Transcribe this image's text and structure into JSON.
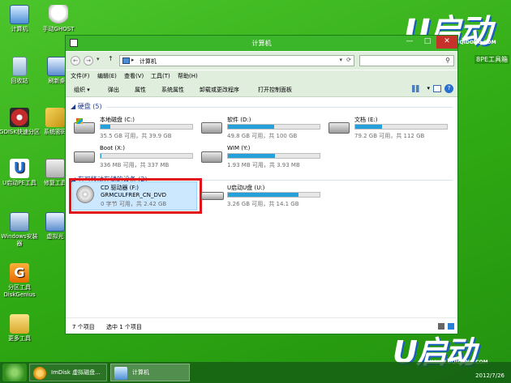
{
  "desktop": {
    "icons": [
      {
        "label": "计算机",
        "icon": "computer-icon"
      },
      {
        "label": "手动GHOST",
        "icon": "ghost-icon"
      },
      {
        "label": "回收站",
        "icon": "recycle-bin-icon"
      },
      {
        "label": "刷新桌",
        "icon": "network-icon"
      },
      {
        "label": "GDISK快速分区",
        "icon": "disk-icon"
      },
      {
        "label": "系统密码",
        "icon": "key-icon"
      },
      {
        "label": "U启动PE工具",
        "icon": "u-logo-icon"
      },
      {
        "label": "修复工具",
        "icon": "tool-icon"
      },
      {
        "label": "Windows安装器",
        "icon": "windows-installer-icon"
      },
      {
        "label": "虚拟光",
        "icon": "network-icon"
      },
      {
        "label": "分区工具DiskGenius",
        "icon": "diskgenius-icon"
      },
      {
        "label": "更多工具",
        "icon": "folder-icon"
      }
    ],
    "logo_text": "启动",
    "logo_letter": "U",
    "logo_url": "WWW.UQIDONG.COM",
    "pe_text": "8PE工具箱",
    "bottom_logo_text": "启动",
    "bottom_logo_url": "WWW.UQIDONG.COM",
    "date": "2012/7/26"
  },
  "window": {
    "title": "计算机",
    "minimize": "—",
    "maximize": "□",
    "close": "✕",
    "address": {
      "location": "计算机",
      "back": "←",
      "forward": "→",
      "up": "↑"
    },
    "menu": [
      "文件(F)",
      "编辑(E)",
      "查看(V)",
      "工具(T)",
      "帮助(H)"
    ],
    "toolbar": [
      "组织 ▾",
      "弹出",
      "属性",
      "系统属性",
      "卸载或更改程序",
      "打开控制面板"
    ],
    "help": "?",
    "groups": {
      "hard_disks": "硬盘 (5)",
      "removable": "有可移动存储的设备 (2)"
    },
    "drives": [
      {
        "name": "本地磁盘 (C:)",
        "free": "35.5 GB 可用，共 39.9 GB",
        "used_fraction": 0.11,
        "win": true
      },
      {
        "name": "软件 (D:)",
        "free": "49.8 GB 可用，共 100 GB",
        "used_fraction": 0.5,
        "win": false
      },
      {
        "name": "文档 (E:)",
        "free": "79.2 GB 可用，共 112 GB",
        "used_fraction": 0.29,
        "win": false
      },
      {
        "name": "Boot (X:)",
        "free": "336 MB 可用，共 337 MB",
        "used_fraction": 0.01,
        "win": false
      },
      {
        "name": "WIM (Y:)",
        "free": "1.93 MB 可用，共 3.93 MB",
        "used_fraction": 0.51,
        "win": false
      }
    ],
    "cd_drive": {
      "name": "CD 驱动器 (F:)",
      "volume": "GRMCULFRER_CN_DVD",
      "free": "0 字节 可用，共 2.42 GB"
    },
    "usb_drive": {
      "name": "U启动U盘 (U:)",
      "free": "3.26 GB 可用，共 14.1 GB",
      "used_fraction": 0.77
    },
    "status": {
      "count": "7 个项目",
      "selected": "选中 1 个项目"
    }
  },
  "taskbar": {
    "tasks": [
      "ImDisk 虚拟磁盘...",
      "计算机"
    ]
  }
}
